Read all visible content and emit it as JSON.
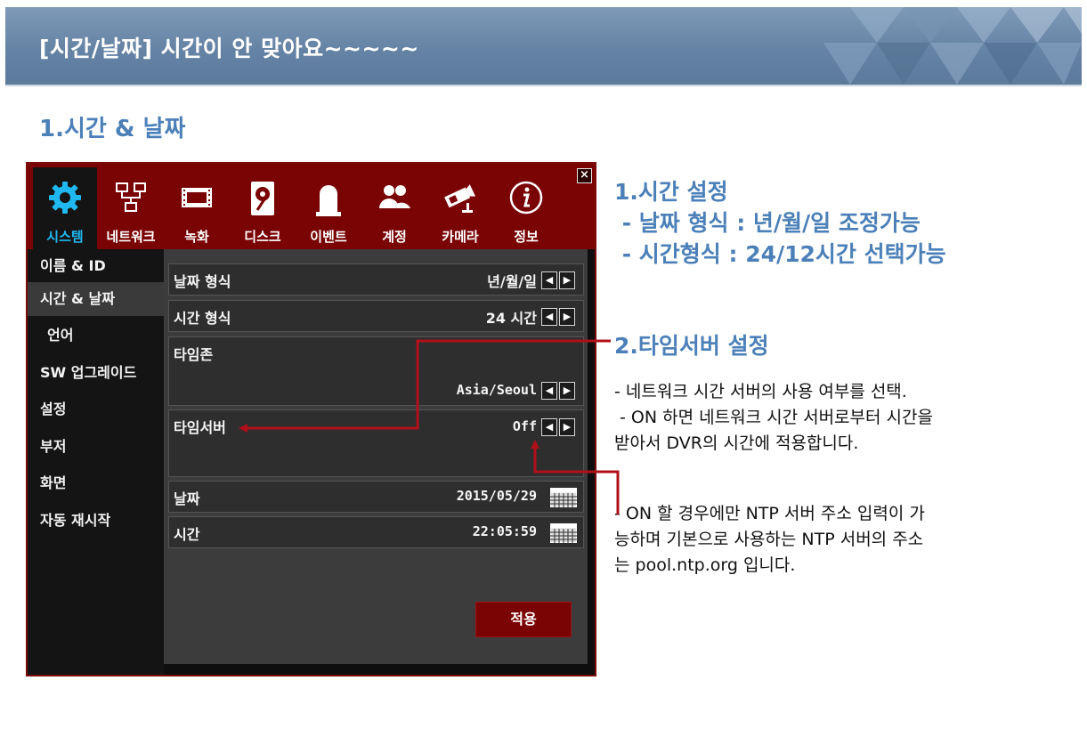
{
  "slide": {
    "title": "[시간/날짜] 시간이 안 맞아요~~~~~",
    "section": "1.시간 & 날짜"
  },
  "dvr": {
    "tabs": [
      {
        "label": "시스템",
        "icon": "gear-icon",
        "active": true
      },
      {
        "label": "네트워크",
        "icon": "network-icon"
      },
      {
        "label": "녹화",
        "icon": "film-icon"
      },
      {
        "label": "디스크",
        "icon": "disk-icon"
      },
      {
        "label": "이벤트",
        "icon": "alarm-light-icon"
      },
      {
        "label": "계정",
        "icon": "users-icon"
      },
      {
        "label": "카메라",
        "icon": "camera-icon"
      },
      {
        "label": "정보",
        "icon": "info-icon"
      }
    ],
    "sidebar": [
      {
        "label": "이름 & ID"
      },
      {
        "label": "시간 & 날짜",
        "active": true
      },
      {
        "label": "언어"
      },
      {
        "label": "SW 업그레이드"
      },
      {
        "label": "설정"
      },
      {
        "label": "부저"
      },
      {
        "label": "화면"
      },
      {
        "label": "자동 재시작"
      }
    ],
    "settings": {
      "date_format": {
        "label": "날짜 형식",
        "value": "년/월/일"
      },
      "time_format": {
        "label": "시간 형식",
        "value": "24 시간"
      },
      "timezone": {
        "label": "타임존",
        "value": "Asia/Seoul"
      },
      "time_server": {
        "label": "타임서버",
        "value": "Off"
      },
      "date": {
        "label": "날짜",
        "value": "2015/05/29"
      },
      "time": {
        "label": "시간",
        "value": "22:05:59"
      }
    },
    "apply_label": "적용",
    "close_label": "×",
    "colors": {
      "accent": "#7a0303",
      "active_tab_text": "#1fb8f0"
    }
  },
  "notes": {
    "time_setting": {
      "heading": "1.시간 설정",
      "line1": " - 날짜 형식 : 년/월/일 조정가능",
      "line2": " - 시간형식 : 24/12시간 선택가능"
    },
    "time_server": {
      "heading": "2.타임서버 설정",
      "line1": "- 네트워크 시간 서버의 사용 여부를 선택.",
      "line2": " - ON 하면 네트워크 시간 서버로부터 시간을",
      "line3": "받아서 DVR의 시간에 적용합니다.",
      "ntp1": "- ON 할 경우에만 NTP 서버 주소 입력이 가",
      "ntp2": "능하며 기본으로 사용하는 NTP 서버의 주소",
      "ntp3": "는 pool.ntp.org 입니다."
    }
  },
  "theme": {
    "heading_blue": "#4c80b8",
    "banner": "#6583a4",
    "callout_red": "#b0101a"
  }
}
